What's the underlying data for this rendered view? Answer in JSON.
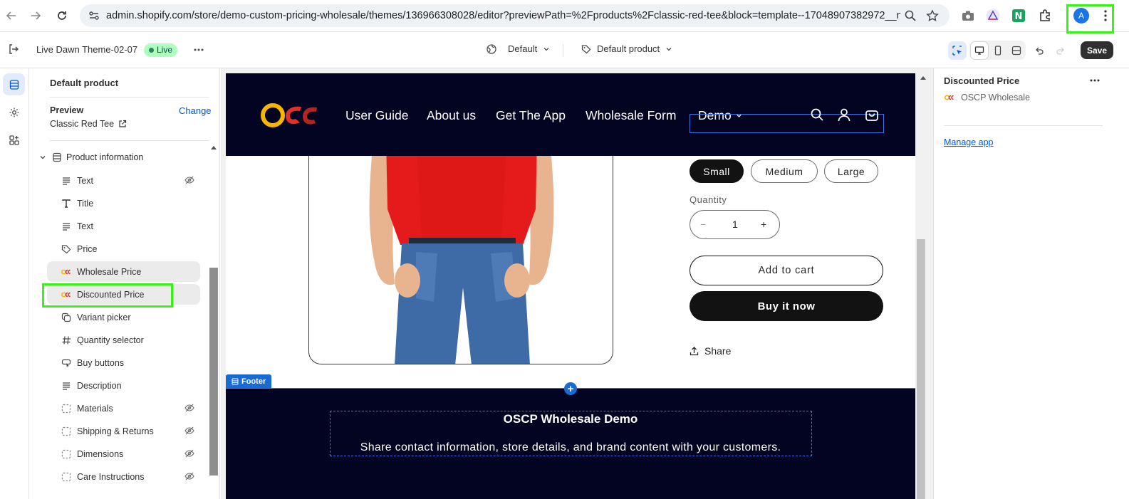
{
  "browser": {
    "url": "admin.shopify.com/store/demo-custom-pricing-wholesale/themes/136966308028/editor?previewPath=%2Fproducts%2Fclassic-red-tee&block=template--17048907382972__main_...",
    "profile_initial": "A"
  },
  "topbar": {
    "theme_name": "Live Dawn Theme-02-07",
    "live_badge": "Live",
    "template_dropdown": "Default",
    "product_dropdown": "Default product",
    "save_label": "Save"
  },
  "sidebar": {
    "title": "Default product",
    "preview_label": "Preview",
    "preview_value": "Classic Red Tee",
    "change_link": "Change",
    "section_title": "Product information",
    "blocks": [
      {
        "label": "Text",
        "icon": "text-lines-icon",
        "hidden": true
      },
      {
        "label": "Title",
        "icon": "title-icon",
        "hidden": false
      },
      {
        "label": "Text",
        "icon": "text-lines-icon",
        "hidden": false
      },
      {
        "label": "Price",
        "icon": "price-tag-icon",
        "hidden": false
      },
      {
        "label": "Wholesale Price",
        "icon": "osc-app-icon",
        "hidden": false
      },
      {
        "label": "Discounted Price",
        "icon": "osc-app-icon",
        "hidden": false
      },
      {
        "label": "Variant picker",
        "icon": "variant-icon",
        "hidden": false
      },
      {
        "label": "Quantity selector",
        "icon": "hash-icon",
        "hidden": false
      },
      {
        "label": "Buy buttons",
        "icon": "buy-buttons-icon",
        "hidden": false
      },
      {
        "label": "Description",
        "icon": "text-lines-icon",
        "hidden": false
      },
      {
        "label": "Materials",
        "icon": "collapsible-icon",
        "hidden": true
      },
      {
        "label": "Shipping & Returns",
        "icon": "collapsible-icon",
        "hidden": true
      },
      {
        "label": "Dimensions",
        "icon": "collapsible-icon",
        "hidden": true
      },
      {
        "label": "Care Instructions",
        "icon": "collapsible-icon",
        "hidden": true
      }
    ]
  },
  "store": {
    "nav": [
      "User Guide",
      "About us",
      "Get The App",
      "Wholesale Form",
      "Demo"
    ],
    "sizes": [
      "Small",
      "Medium",
      "Large"
    ],
    "selected_size": "Small",
    "quantity_label": "Quantity",
    "quantity_value": "1",
    "qty_minus": "−",
    "qty_plus": "+",
    "add_to_cart": "Add to cart",
    "buy_now": "Buy it now",
    "share": "Share",
    "footer_tag": "Footer",
    "footer_title": "OSCP Wholesale Demo",
    "footer_text": "Share contact information, store details, and brand content with your customers."
  },
  "right_panel": {
    "title": "Discounted Price",
    "app_name": "OSCP Wholesale",
    "manage_link": "Manage app"
  },
  "colors": {
    "highlight": "#39f218",
    "store_header_bg": "#030322",
    "selection_blue": "#3f73e6",
    "link_blue": "#005bd3"
  }
}
